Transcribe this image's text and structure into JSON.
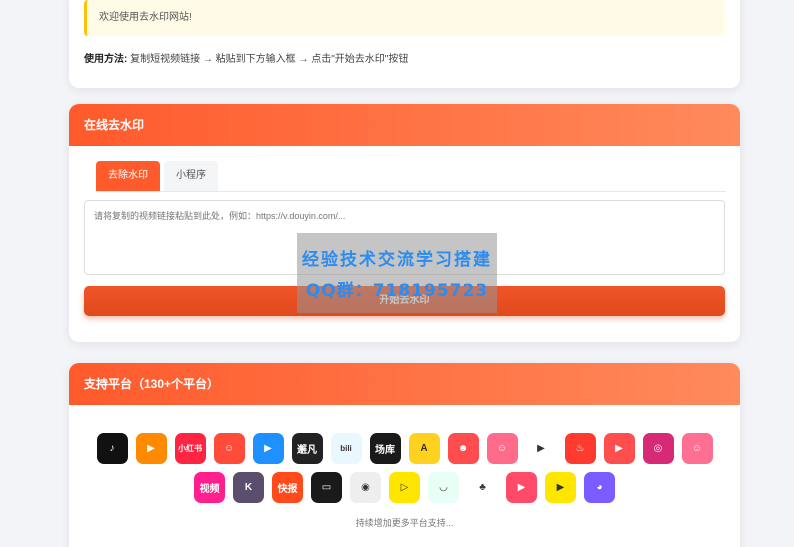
{
  "top": {
    "notice": "欢迎使用去水印网站!",
    "usage_label": "使用方法:",
    "usage_text": "复制短视频链接 → 粘贴到下方输入框 → 点击\"开始去水印\"按钮"
  },
  "tool": {
    "title": "在线去水印",
    "tabs": [
      {
        "label": "去除水印"
      },
      {
        "label": "小程序"
      }
    ],
    "placeholder": "请将复制的视频链接粘贴到此处，例如：https://v.douyin.com/...",
    "button": "开始去水印"
  },
  "watermark": {
    "line1": "经验技术交流学习搭建",
    "line2": "QQ群：718195723"
  },
  "platforms": {
    "title": "支持平台（130+个平台）",
    "more": "持续增加更多平台支持...",
    "row1": [
      {
        "name": "douyin-icon",
        "bg": "#111111",
        "glyph": "♪"
      },
      {
        "name": "kuaishou-icon",
        "bg": "#ff8a00",
        "glyph": "▶"
      },
      {
        "name": "xiaohongshu-icon",
        "bg": "#ff2442",
        "glyph": "小红书"
      },
      {
        "name": "pipixia-icon",
        "bg": "#ff4b3a",
        "glyph": "☺"
      },
      {
        "name": "youku-icon",
        "bg": "#1e90ff",
        "glyph": "▶"
      },
      {
        "name": "bizhi-icon",
        "bg": "#222222",
        "glyph": "邂凡"
      },
      {
        "name": "bilibili-icon",
        "bg": "#e9f7ff",
        "glyph": "bili"
      },
      {
        "name": "changku-icon",
        "bg": "#1a1a1a",
        "glyph": "场库"
      },
      {
        "name": "zuiyou-icon",
        "bg": "#ffd21f",
        "glyph": "A"
      },
      {
        "name": "monkey-icon",
        "bg": "#ff4d4f",
        "glyph": "☻"
      },
      {
        "name": "face-icon",
        "bg": "#ff6b8a",
        "glyph": "☺"
      },
      {
        "name": "play-icon",
        "bg": "#ffffff",
        "glyph": "▶"
      },
      {
        "name": "huoshan-icon",
        "bg": "#ff3b30",
        "glyph": "♨"
      },
      {
        "name": "weishi-icon",
        "bg": "#ff4e4e",
        "glyph": "▶"
      },
      {
        "name": "instagram-icon",
        "bg": "#d62976",
        "glyph": "◎"
      },
      {
        "name": "gaoxiao-icon",
        "bg": "#ff6f91",
        "glyph": "☺"
      }
    ],
    "row2": [
      {
        "name": "shipin-icon",
        "bg": "#ff1f8e",
        "glyph": "视频"
      },
      {
        "name": "kuai-icon",
        "bg": "#5a4e6c",
        "glyph": "K"
      },
      {
        "name": "kuaibao-icon",
        "bg": "#ff4a1c",
        "glyph": "快报"
      },
      {
        "name": "tv-icon",
        "bg": "#1a1a1a",
        "glyph": "▭"
      },
      {
        "name": "eye-icon",
        "bg": "#eeeeee",
        "glyph": "◉"
      },
      {
        "name": "yellow-play-icon",
        "bg": "#ffe600",
        "glyph": "▷"
      },
      {
        "name": "bowl-icon",
        "bg": "#e8fff6",
        "glyph": "◡"
      },
      {
        "name": "plant-icon",
        "bg": "#ffffff",
        "glyph": "♣"
      },
      {
        "name": "video-icon",
        "bg": "#ff4a6a",
        "glyph": "▶"
      },
      {
        "name": "circle-play-icon",
        "bg": "#ffe600",
        "glyph": "▶"
      },
      {
        "name": "chat-icon",
        "bg": "#7a5cff",
        "glyph": "◕"
      }
    ]
  }
}
